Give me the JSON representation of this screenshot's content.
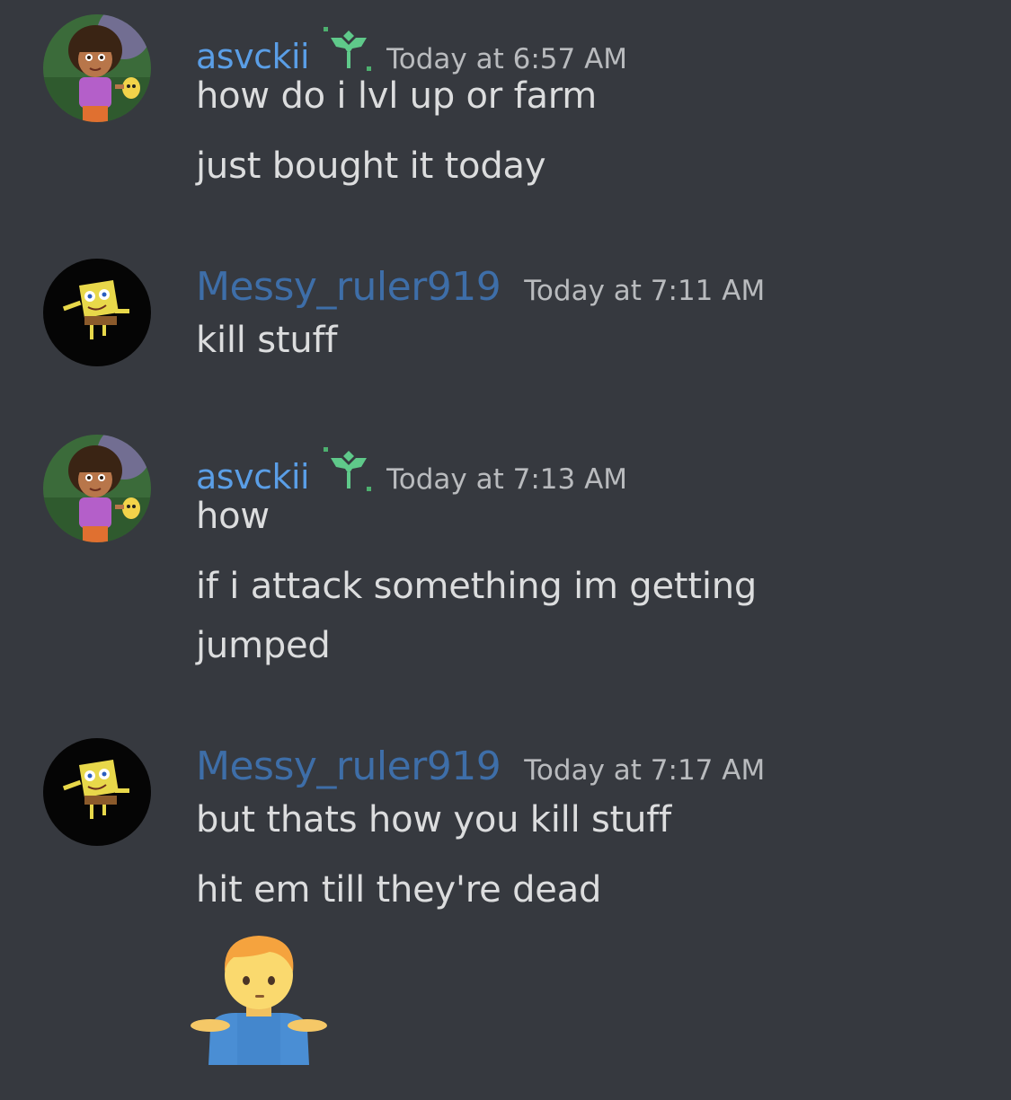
{
  "messages": [
    {
      "username": "asvckii",
      "timestamp": "Today at 6:57 AM",
      "lines": [
        "how do i lvl up or farm",
        "just bought it today"
      ]
    },
    {
      "username": "Messy_ruler919",
      "timestamp": "Today at 7:11 AM",
      "lines": [
        "kill stuff"
      ]
    },
    {
      "username": "asvckii",
      "timestamp": "Today at 7:13 AM",
      "lines": [
        "how",
        "if i attack something im getting",
        "jumped"
      ]
    },
    {
      "username": "Messy_ruler919",
      "timestamp": "Today at 7:17 AM",
      "lines": [
        "but thats how you kill stuff",
        "hit em till they're dead"
      ]
    }
  ],
  "colors": {
    "background": "#36393f",
    "asvckii_name": "#5a9ee6",
    "messy_name": "#3e6ea8",
    "timestamp": "#b9bbbe",
    "text": "#dcddde"
  },
  "icons": {
    "asvckii_avatar": "dora-avatar",
    "messy_avatar": "spongebob-avatar",
    "badge": "plant-sprout-badge-icon",
    "reaction_emoji": "man-shrugging-emoji"
  }
}
